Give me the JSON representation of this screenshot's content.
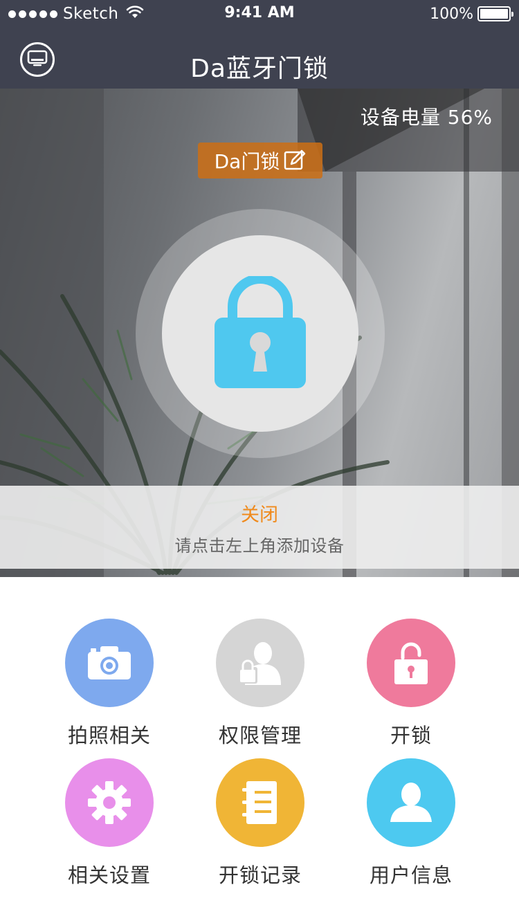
{
  "status_bar": {
    "carrier": "Sketch",
    "time": "9:41 AM",
    "battery_percent": "100%"
  },
  "nav": {
    "title": "Da蓝牙门锁",
    "left_icon": "device-screen-icon"
  },
  "hero": {
    "battery_label": "设备电量 56%",
    "device_name": "Da门锁",
    "edit_icon": "edit-icon",
    "lock_icon": "padlock-icon",
    "lock_status": "关闭",
    "hint": "请点击左上角添加设备"
  },
  "colors": {
    "header_bg": "#3f4250",
    "lock_blue": "#4fc8ef",
    "status_orange": "#f08a1c",
    "tag_orange": "#cd6e14"
  },
  "functions": [
    {
      "label": "拍照相关",
      "icon": "camera-icon",
      "color": "#7ea9ee"
    },
    {
      "label": "权限管理",
      "icon": "user-lock-icon",
      "color": "#d5d5d5"
    },
    {
      "label": "开锁",
      "icon": "unlock-icon",
      "color": "#ef7a9c"
    },
    {
      "label": "相关设置",
      "icon": "gear-icon",
      "color": "#e88fea"
    },
    {
      "label": "开锁记录",
      "icon": "notebook-icon",
      "color": "#f0b536"
    },
    {
      "label": "用户信息",
      "icon": "user-icon",
      "color": "#4dc9f0"
    }
  ]
}
